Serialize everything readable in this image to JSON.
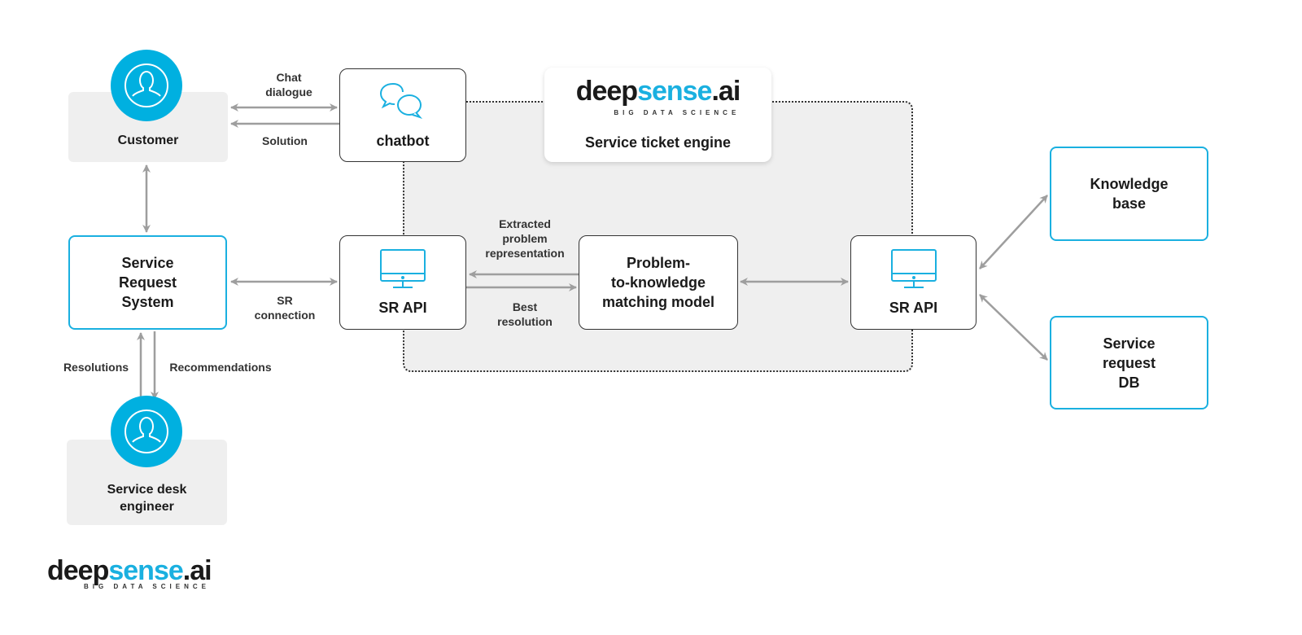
{
  "colors": {
    "accent": "#1ab0e0",
    "arrow": "#9e9e9e",
    "region": "#efefef"
  },
  "nodes": {
    "customer": "Customer",
    "chatbot": "chatbot",
    "engine_title": "Service ticket engine",
    "srs": [
      "Service",
      "Request",
      "System"
    ],
    "sr_api_left": "SR API",
    "model": [
      "Problem-",
      "to-knowledge",
      "matching model"
    ],
    "sr_api_right": "SR API",
    "knowledge_base": [
      "Knowledge",
      "base"
    ],
    "sr_db": [
      "Service",
      "request",
      "DB"
    ],
    "engineer": [
      "Service desk",
      "engineer"
    ]
  },
  "edges": {
    "chat": [
      "Chat",
      "dialogue"
    ],
    "solution": "Solution",
    "sr_connection": [
      "SR",
      "connection"
    ],
    "extracted": [
      "Extracted",
      "problem",
      "representation"
    ],
    "best": [
      "Best",
      "resolution"
    ],
    "resolutions": "Resolutions",
    "recommendations": "Recommendations"
  },
  "logo": {
    "part1": "deep",
    "part2": "sense",
    "part3": ".ai",
    "tagline": "BIG DATA SCIENCE"
  },
  "icons": {
    "person": "user-icon",
    "chat": "chat-bubbles-icon",
    "monitor": "monitor-icon"
  }
}
